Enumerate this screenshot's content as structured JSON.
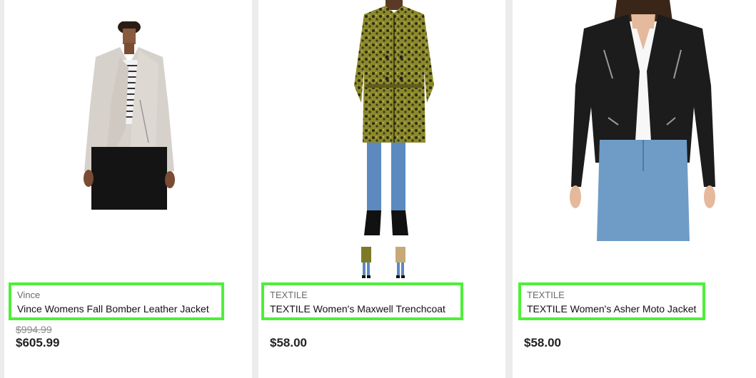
{
  "products": [
    {
      "brand": "Vince",
      "title": "Vince Womens Fall Bomber Leather Jacket",
      "original_price": "$994.99",
      "price": "$605.99",
      "image": "beige-leather-jacket"
    },
    {
      "brand": "TEXTILE",
      "title": "TEXTILE Women's Maxwell Trenchcoat",
      "price": "$58.00",
      "image": "leopard-trenchcoat",
      "thumbnails": [
        "leopard-trenchcoat-thumb",
        "camel-trenchcoat-thumb"
      ]
    },
    {
      "brand": "TEXTILE",
      "title": "TEXTILE Women's Asher Moto Jacket",
      "price": "$58.00",
      "image": "black-moto-jacket"
    }
  ],
  "colors": {
    "highlight_border": "#4ef03a",
    "background": "#ececec",
    "card": "#ffffff"
  }
}
